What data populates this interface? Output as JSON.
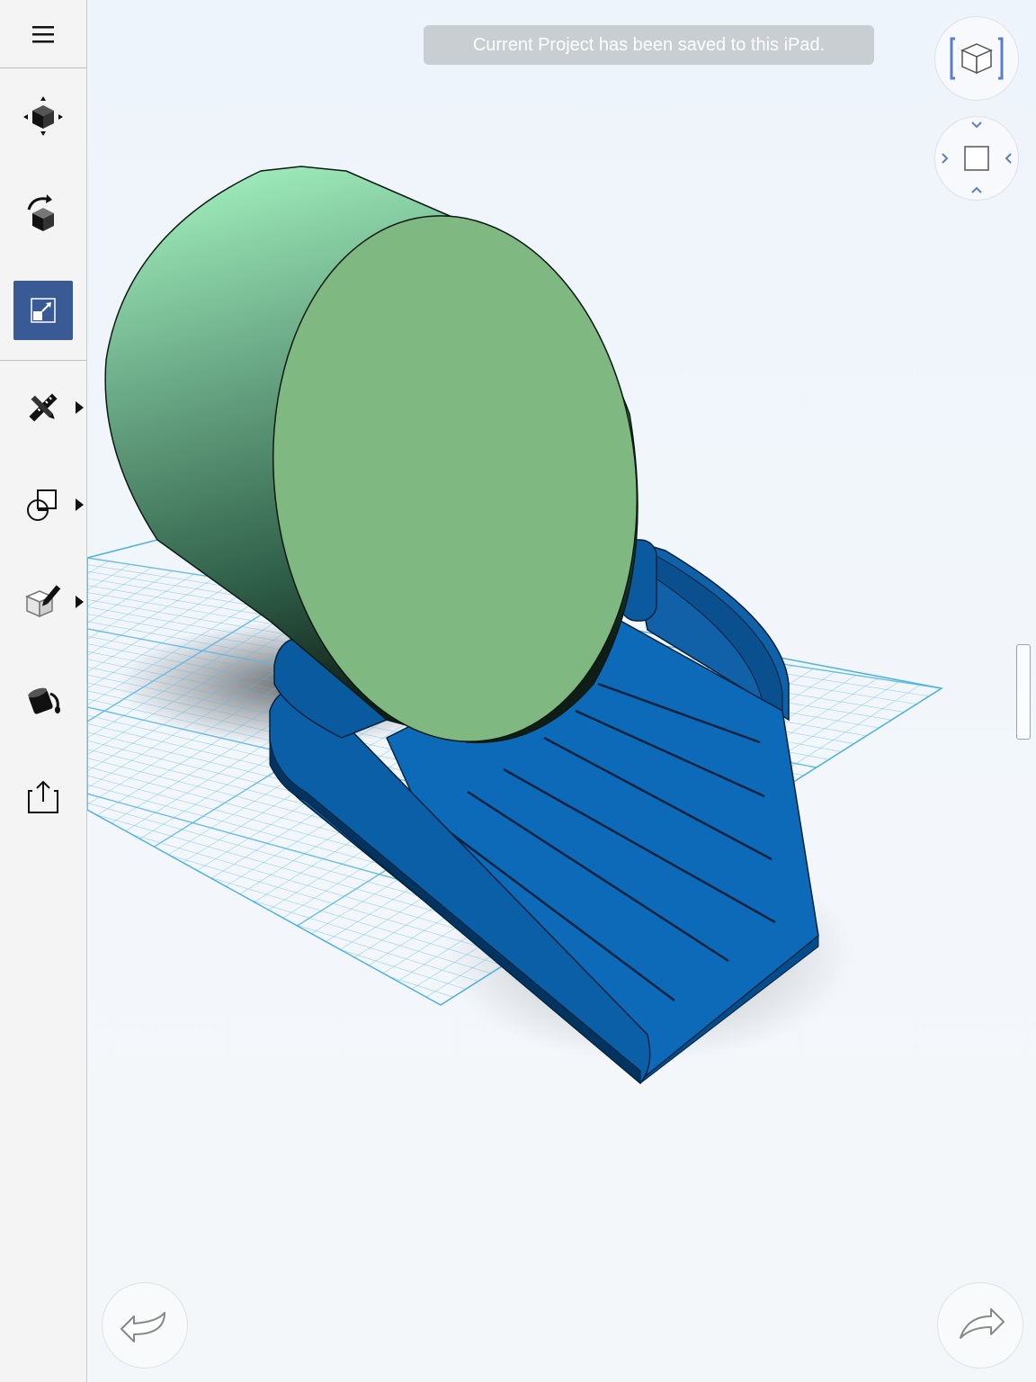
{
  "toast": {
    "message": "Current Project has been saved to this iPad."
  },
  "sidebar": {
    "items": [
      {
        "name": "move-tool",
        "icon": "move-cube-icon"
      },
      {
        "name": "rotate-tool",
        "icon": "rotate-cube-icon"
      },
      {
        "name": "scale-tool",
        "icon": "scale-icon",
        "active": true
      },
      {
        "name": "sketch-tools",
        "icon": "pencil-ruler-icon",
        "has_submenu": true
      },
      {
        "name": "primitives",
        "icon": "shapes-icon",
        "has_submenu": true
      },
      {
        "name": "modify-tools",
        "icon": "edit-cube-icon",
        "has_submenu": true
      },
      {
        "name": "material-tool",
        "icon": "paint-bucket-icon"
      },
      {
        "name": "export-tool",
        "icon": "share-icon"
      }
    ]
  },
  "view_controls": {
    "view_cube": "view-cube-icon",
    "orbit_pad": "orbit-pad-icon"
  },
  "history": {
    "undo": "undo-icon",
    "redo": "redo-icon"
  },
  "colors": {
    "cylinder_face": "#7fb880",
    "cylinder_side_top": "#a6f7c2",
    "base_blue": "#0d6ab8",
    "base_blue_dark": "#054a86",
    "grid_line": "#5ab8e6",
    "accent": "#3a5a96"
  }
}
